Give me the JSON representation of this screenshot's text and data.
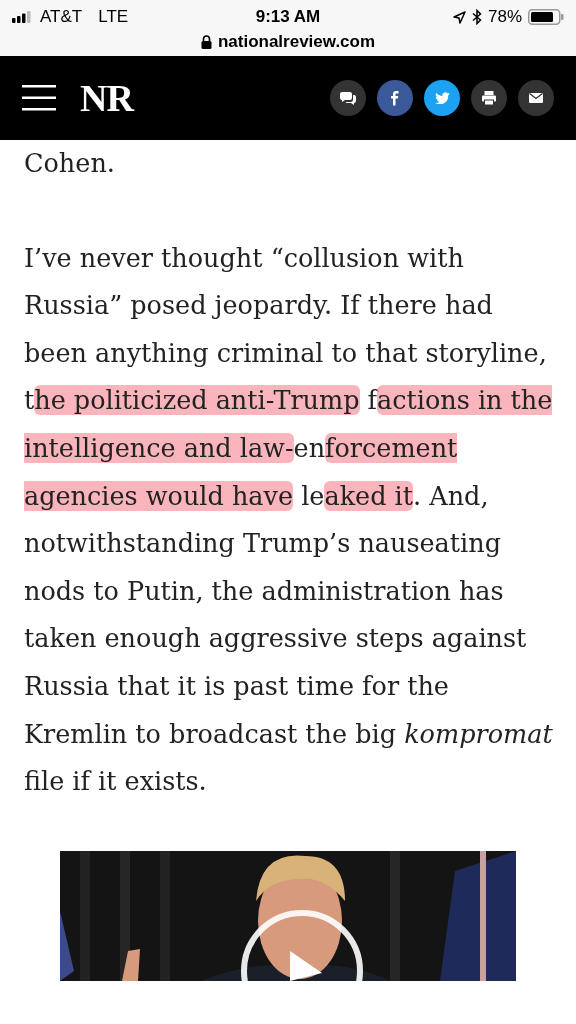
{
  "status_bar": {
    "carrier": "AT&T",
    "network": "LTE",
    "time": "9:13 AM",
    "battery": "78%"
  },
  "address_bar": {
    "url": "nationalreview.com"
  },
  "header": {
    "logo": "NR",
    "share_buttons": [
      {
        "kind": "comments"
      },
      {
        "kind": "facebook"
      },
      {
        "kind": "twitter"
      },
      {
        "kind": "print"
      },
      {
        "kind": "email"
      }
    ]
  },
  "article": {
    "paragraphs": [
      [
        {
          "text": "Cohen.",
          "highlighted": false
        }
      ],
      [
        {
          "text": "I’ve never thought “collusion with Russia” posed jeopardy. If there had been anything criminal to that storyline, t",
          "highlighted": false
        },
        {
          "text": "he politicized anti-Trump",
          "highlighted": true
        },
        {
          "text": " f",
          "highlighted": false
        },
        {
          "text": "actions in the intelligence and law-",
          "highlighted": true
        },
        {
          "text": "en",
          "highlighted": false
        },
        {
          "text": "forcement agencies would have",
          "highlighted": true
        },
        {
          "text": " le",
          "highlighted": false
        },
        {
          "text": "aked it",
          "highlighted": true
        },
        {
          "text": ". And, notwithstanding Trump’s nauseating nods to Putin, the administration has taken enough aggressive steps against Russia that it is past time for the Kremlin to broadcast the big *kompromat* file if it exists.",
          "highlighted": false
        }
      ]
    ],
    "video": {
      "kind": "picture"
    }
  }
}
